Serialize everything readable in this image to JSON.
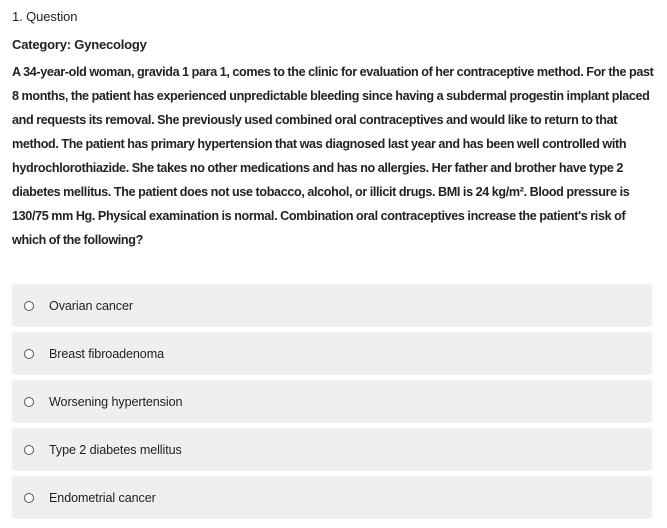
{
  "question": {
    "header": "1. Question",
    "category": "Category: Gynecology",
    "stem_lines": [
      "A 34-year-old woman, gravida 1 para 1, comes to the clinic for evaluation of her contraceptive method.  For the past",
      "8 months, the patient has experienced unpredictable bleeding since having a subdermal progestin implant placed",
      "and requests its removal.  She previously used combined oral contraceptives and would like to return to that",
      "method.  The patient has primary hypertension that was diagnosed last year and has been well controlled with",
      "hydrochlorothiazide.  She takes no other medications and has no allergies.  Her father and brother have type 2",
      "diabetes mellitus.  The patient does not use tobacco, alcohol, or illicit drugs.  BMI is 24 kg/m².  Blood pressure is",
      "130/75 mm Hg.  Physical examination is normal.  Combination oral contraceptives increase the patient's risk of",
      "which of the following?"
    ]
  },
  "options": [
    {
      "label": "Ovarian cancer"
    },
    {
      "label": "Breast fibroadenoma"
    },
    {
      "label": "Worsening hypertension"
    },
    {
      "label": "Type 2 diabetes mellitus"
    },
    {
      "label": "Endometrial cancer"
    }
  ]
}
